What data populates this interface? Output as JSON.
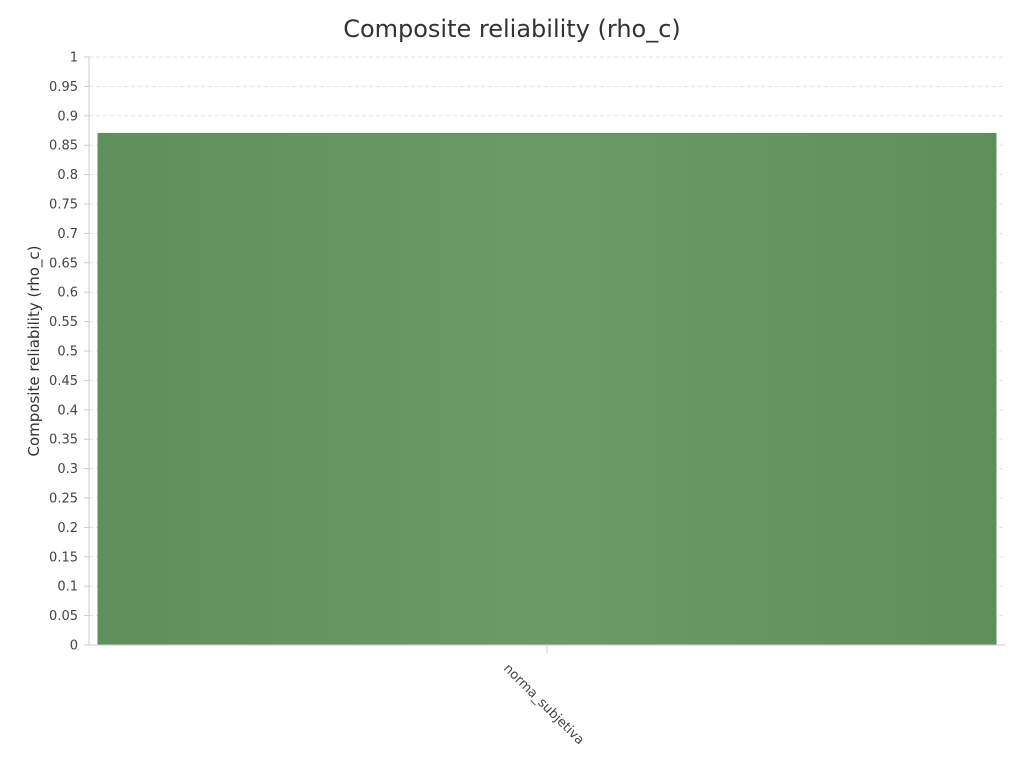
{
  "chart_data": {
    "type": "bar",
    "title": "Composite reliability (rho_c)",
    "xlabel": "",
    "ylabel": "Composite reliability (rho_c)",
    "categories": [
      "norma_subjetiva"
    ],
    "values": [
      0.87
    ],
    "ylim": [
      0,
      1
    ],
    "yticks": [
      0,
      0.05,
      0.1,
      0.15,
      0.2,
      0.25,
      0.3,
      0.35,
      0.4,
      0.45,
      0.5,
      0.55,
      0.6,
      0.65,
      0.7,
      0.75,
      0.8,
      0.85,
      0.9,
      0.95,
      1
    ],
    "grid": true,
    "legend": "none",
    "colors": {
      "bar": "#6a9a66",
      "bar_edge": "#5f8f5b",
      "grid": "#e3e3e3",
      "axis": "#cccccc"
    }
  }
}
